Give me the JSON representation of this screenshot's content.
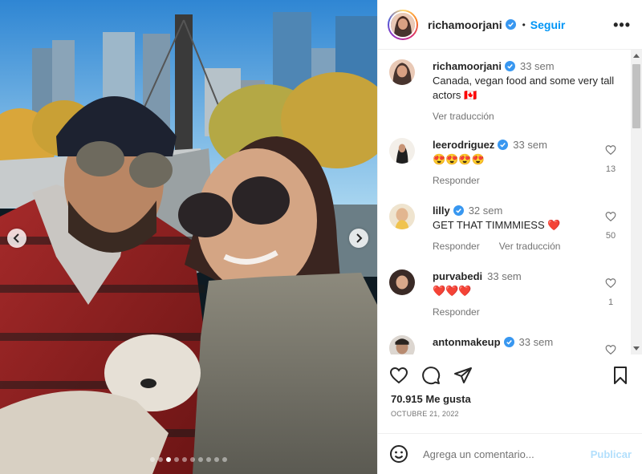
{
  "post": {
    "username": "richamoorjani",
    "follow_label": "Seguir",
    "more_label": "•••",
    "likes": "70.915 Me gusta",
    "date": "OCTUBRE 21, 2022",
    "comment_placeholder": "Agrega un comentario...",
    "publish_label": "Publicar",
    "carousel": {
      "slide_count": 10,
      "active_index": 2
    }
  },
  "caption": {
    "username": "richamoorjani",
    "time": "33 sem",
    "text": "Canada, vegan food and some very tall actors 🇨🇦",
    "see_translation": "Ver traducción"
  },
  "comments": [
    {
      "username": "leerodriguez",
      "verified": true,
      "time": "33 sem",
      "text": "😍😍😍😍",
      "reply": "Responder",
      "likes": "13"
    },
    {
      "username": "lilly",
      "verified": true,
      "time": "32 sem",
      "text": "GET THAT TIMMMIESS ❤️",
      "reply": "Responder",
      "translation": "Ver traducción",
      "likes": "50"
    },
    {
      "username": "purvabedi",
      "verified": false,
      "time": "33 sem",
      "text": "❤️❤️❤️",
      "reply": "Responder",
      "likes": "1"
    },
    {
      "username": "antonmakeup",
      "verified": true,
      "time": "33 sem",
      "text": "",
      "reply": "",
      "likes": ""
    }
  ],
  "colors": {
    "accent": "#0095f6",
    "verified": "#3897f0",
    "heart": "#ed1c24",
    "muted": "#737373"
  }
}
